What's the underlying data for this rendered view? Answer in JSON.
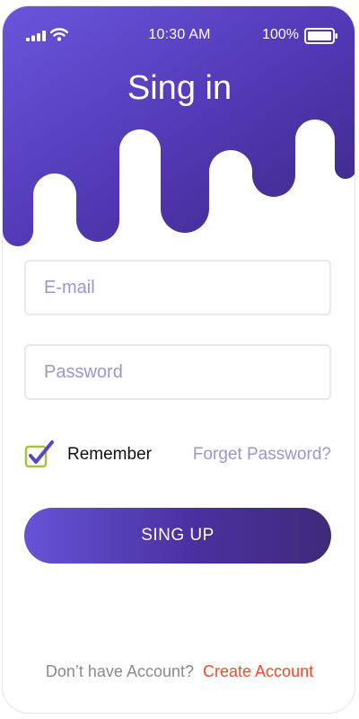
{
  "status_bar": {
    "time": "10:30 AM",
    "battery_percent": "100%",
    "icons": [
      "signal-icon",
      "wifi-icon",
      "battery-icon"
    ]
  },
  "header": {
    "title": "Sing in"
  },
  "form": {
    "email_placeholder": "E-mail",
    "email_value": "",
    "password_placeholder": "Password",
    "password_value": "",
    "remember_label": "Remember",
    "remember_checked": true,
    "forgot_label": "Forget Password?",
    "submit_label": "SING UP"
  },
  "footer": {
    "prompt": "Don’t have Account?",
    "create_label": "Create Account"
  },
  "colors": {
    "primary": "#5a45c9",
    "primary_dark": "#3f2a7a",
    "placeholder": "#9b95d2",
    "accent_link": "#f04a2a",
    "checkbox_green": "#a4c43a"
  }
}
